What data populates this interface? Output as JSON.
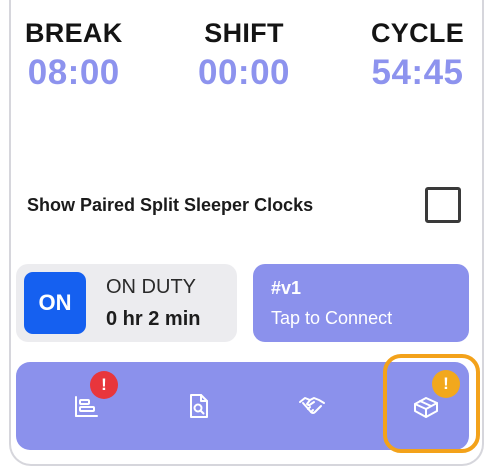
{
  "clocks": [
    {
      "label": "BREAK",
      "value": "08:00"
    },
    {
      "label": "SHIFT",
      "value": "00:00"
    },
    {
      "label": "CYCLE",
      "value": "54:45"
    }
  ],
  "paired_split": {
    "label": "Show Paired Split Sleeper Clocks",
    "checked": false
  },
  "duty": {
    "toggle_label": "ON",
    "status": "ON DUTY",
    "elapsed": "0 hr 2 min"
  },
  "connect": {
    "device_id": "#v1",
    "subtitle": "Tap to Connect"
  },
  "bottom_nav": {
    "items": [
      {
        "icon": "logs-icon",
        "badge": "!"
      },
      {
        "icon": "document-search-icon"
      },
      {
        "icon": "handshake-icon"
      },
      {
        "icon": "box-icon",
        "badge": "!"
      }
    ]
  },
  "colors": {
    "accent": "#8b91ec",
    "on_button": "#1560f0",
    "badge_red": "#e8363c",
    "badge_orange": "#f2a81d",
    "highlight": "#f3a21a"
  }
}
